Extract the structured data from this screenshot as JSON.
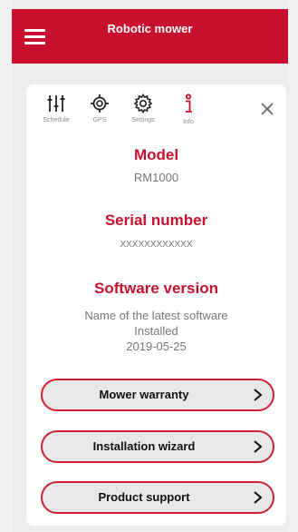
{
  "header": {
    "title": "Robotic mower"
  },
  "toolbar": {
    "items": [
      {
        "label": "Schedule",
        "icon": "schedule-sliders-icon"
      },
      {
        "label": "GPS",
        "icon": "gps-target-icon"
      },
      {
        "label": "Settings",
        "icon": "gear-icon"
      },
      {
        "label": "Info",
        "icon": "info-icon"
      }
    ],
    "close_icon": "close-icon"
  },
  "info": {
    "model_title": "Model",
    "model_value": "RM1000",
    "serial_title": "Serial number",
    "serial_value": "XXXXXXXXXXXX",
    "software_title": "Software version",
    "software_name": "Name of the latest software",
    "software_status": "Installed",
    "software_date": "2019-05-25"
  },
  "actions": [
    {
      "label": "Mower warranty"
    },
    {
      "label": "Installation wizard"
    },
    {
      "label": "Product support"
    }
  ],
  "colors": {
    "brand": "#c8102e",
    "pill_border": "#d1202f",
    "pill_fill": "#e8e8e8"
  }
}
